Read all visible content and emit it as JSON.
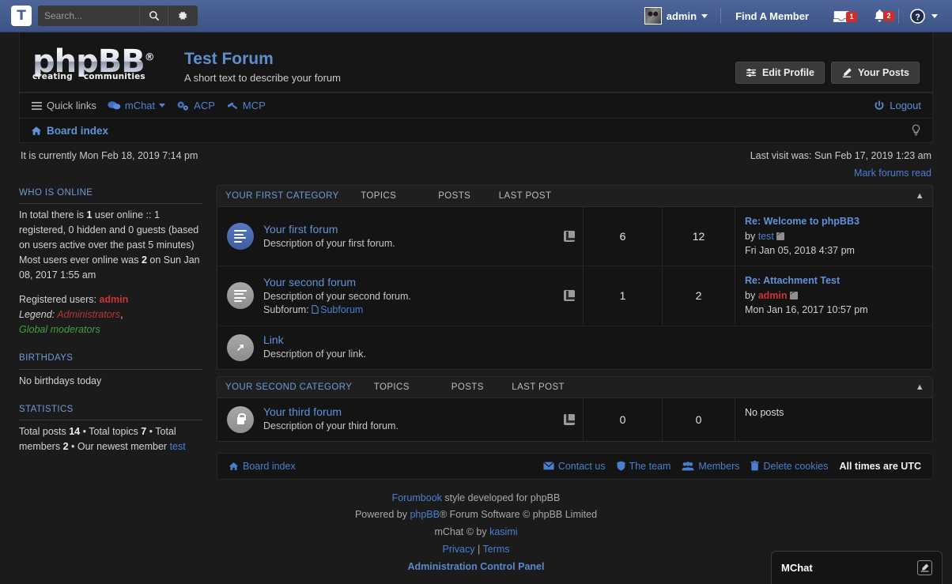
{
  "topbar": {
    "logo_letter": "T",
    "search_placeholder": "Search...",
    "search_value": "",
    "search_icon": "magnifier-icon",
    "settings_icon": "gear-icon",
    "username": "admin",
    "find_member": "Find A Member",
    "messages_badge": "1",
    "notifications_badge": "2",
    "help_icon": "question-mark-icon"
  },
  "header": {
    "logo_word": "phpBB",
    "logo_reg": "®",
    "logo_tag_left": "creating",
    "logo_tag_right": "communities",
    "site_title": "Test Forum",
    "site_desc": "A short text to describe your forum",
    "edit_profile": "Edit Profile",
    "your_posts": "Your Posts"
  },
  "nav": {
    "quick_links": "Quick links",
    "mchat": "mChat",
    "acp": "ACP",
    "mcp": "MCP",
    "logout": "Logout",
    "breadcrumb": "Board index"
  },
  "times": {
    "current": "It is currently Mon Feb 18, 2019 7:14 pm",
    "last_visit": "Last visit was: Sun Feb 17, 2019 1:23 am",
    "mark_forums_read": "Mark forums read"
  },
  "sidebar": {
    "who_is_online": {
      "heading": "Who is online",
      "line1_a": "In total there is ",
      "line1_total": "1",
      "line1_b": " user online :: 1 registered, 0 hidden and 0 guests (based on users active over the past 5 minutes)",
      "line2_a": "Most users ever online was ",
      "line2_peak": "2",
      "line2_b": " on Sun Jan 08, 2017 1:55 am",
      "registered_label": "Registered users: ",
      "registered_user": "admin",
      "legend_label": "Legend: ",
      "legend_admins": "Administrators",
      "legend_sep": ", ",
      "legend_gmods": "Global moderators"
    },
    "birthdays": {
      "heading": "Birthdays",
      "text": "No birthdays today"
    },
    "statistics": {
      "heading": "Statistics",
      "posts_label": "Total posts ",
      "posts": "14",
      "topics_label": " • Total topics ",
      "topics": "7",
      "members_label": " • Total members ",
      "members": "2",
      "newest_label": " • Our newest member ",
      "newest": "test"
    }
  },
  "table_headers": {
    "topics": "Topics",
    "posts": "Posts",
    "last_post": "Last post"
  },
  "categories": [
    {
      "title": "Your first category",
      "forums": [
        {
          "icon": "forum-unread-icon",
          "icon_state": "unread",
          "icon_kind": "lines",
          "name": "Your first forum",
          "desc": "Description of your first forum.",
          "subforum_label": "",
          "subforum_name": "",
          "rss": "rss-icon",
          "topics": "6",
          "posts": "12",
          "last_post_title": "Re: Welcome to phpBB3",
          "last_post_by_label": "by ",
          "last_post_author": "test",
          "last_post_author_admin": false,
          "last_post_date": "Fri Jan 05, 2018 4:37 pm",
          "no_posts": ""
        },
        {
          "icon": "forum-read-icon",
          "icon_state": "read",
          "icon_kind": "lines",
          "name": "Your second forum",
          "desc": "Description of your second forum.",
          "subforum_label": "Subforum: ",
          "subforum_name": "Subforum",
          "rss": "rss-icon",
          "topics": "1",
          "posts": "2",
          "last_post_title": "Re: Attachment Test",
          "last_post_by_label": "by ",
          "last_post_author": "admin",
          "last_post_author_admin": true,
          "last_post_date": "Mon Jan 16, 2017 10:57 pm",
          "no_posts": ""
        },
        {
          "icon": "forum-link-icon",
          "icon_state": "read",
          "icon_kind": "arrow",
          "name": "Link",
          "desc": "Description of your link.",
          "subforum_label": "",
          "subforum_name": "",
          "rss": "",
          "topics": "",
          "posts": "",
          "last_post_title": "",
          "last_post_by_label": "",
          "last_post_author": "",
          "last_post_author_admin": false,
          "last_post_date": "",
          "no_posts": ""
        }
      ]
    },
    {
      "title": "Your second category",
      "forums": [
        {
          "icon": "forum-locked-icon",
          "icon_state": "read",
          "icon_kind": "lock",
          "name": "Your third forum",
          "desc": "Description of your third forum.",
          "subforum_label": "",
          "subforum_name": "",
          "rss": "rss-icon",
          "topics": "0",
          "posts": "0",
          "last_post_title": "",
          "last_post_by_label": "",
          "last_post_author": "",
          "last_post_author_admin": false,
          "last_post_date": "",
          "no_posts": "No posts"
        }
      ]
    }
  ],
  "footer": {
    "board_index": "Board index",
    "contact_us": "Contact us",
    "the_team": "The team",
    "members": "Members",
    "delete_cookies": "Delete cookies",
    "all_times": "All times are UTC",
    "credit_style_link": "Forumbook",
    "credit_style_rest": " style developed for phpBB",
    "credit_powered_pre": "Powered by ",
    "credit_powered_link": "phpBB",
    "credit_powered_post": "® Forum Software © phpBB Limited",
    "credit_mchat_pre": "mChat © by ",
    "credit_mchat_link": "kasimi",
    "privacy": "Privacy",
    "credit_sep": " | ",
    "terms": "Terms",
    "acp_link": "Administration Control Panel"
  },
  "mchat_panel": {
    "title": "MChat",
    "edit_icon": "pencil-square-icon"
  },
  "colors": {
    "accent_blue": "#4a7fd0",
    "topbar_blue": "#4a6296",
    "badge_red": "#d22d2d",
    "admin_red": "#cc3333",
    "gmod_green": "#3f9f3f"
  }
}
